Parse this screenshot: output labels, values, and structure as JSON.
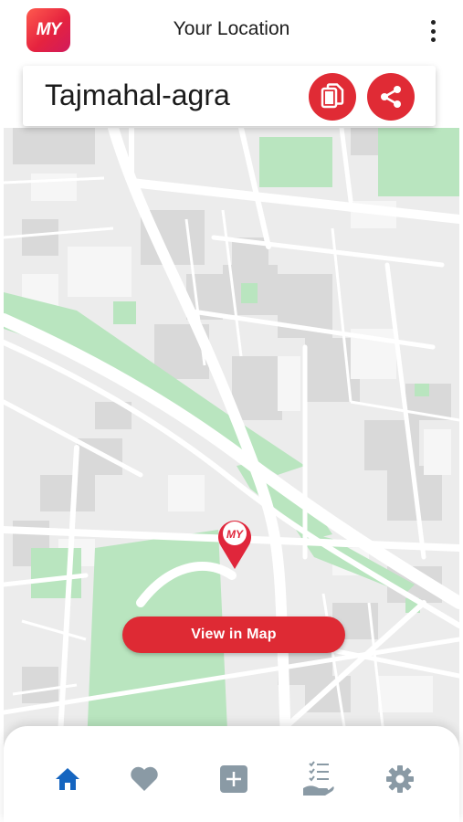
{
  "app": {
    "logo_text": "MY",
    "title": "Your Location"
  },
  "location": {
    "name": "Tajmahal-agra"
  },
  "map": {
    "pin_logo_text": "MY",
    "view_button_label": "View in Map"
  },
  "colors": {
    "accent": "#de2a34",
    "nav_active": "#1565c0",
    "nav_inactive": "#8a9aa5",
    "map_bg": "#ececec",
    "map_block": "#d8d8d8",
    "map_park": "#b7e4bd"
  },
  "icons": {
    "menu": "more-vertical-icon",
    "copy": "copy-icon",
    "share": "share-icon",
    "pin": "map-pin-icon",
    "nav_home": "home-icon",
    "nav_favorites": "heart-icon",
    "nav_add": "plus-square-icon",
    "nav_list": "hand-list-icon",
    "nav_settings": "gear-icon"
  },
  "bottom_nav": {
    "active": "home"
  }
}
